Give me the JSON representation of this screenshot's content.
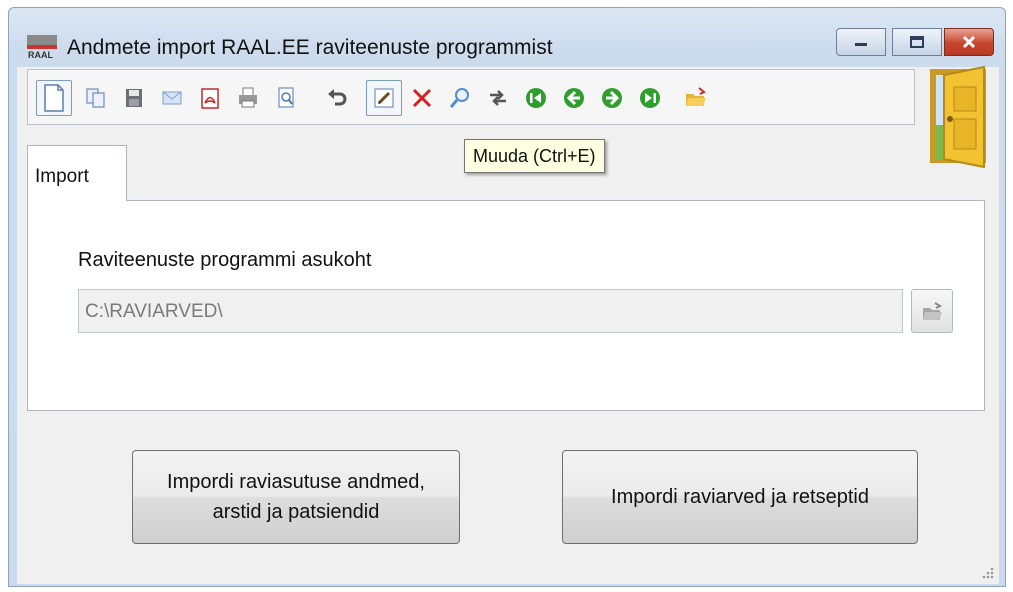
{
  "window": {
    "title": "Andmete import RAAL.EE raviteenuste programmist"
  },
  "toolbar": {
    "items": [
      {
        "name": "new-document-icon"
      },
      {
        "name": "copy-icon"
      },
      {
        "name": "save-icon"
      },
      {
        "name": "email-icon"
      },
      {
        "name": "pdf-icon"
      },
      {
        "name": "print-icon"
      },
      {
        "name": "print-preview-icon"
      },
      {
        "name": "undo-icon"
      },
      {
        "name": "edit-icon"
      },
      {
        "name": "delete-icon"
      },
      {
        "name": "search-icon"
      },
      {
        "name": "refresh-icon"
      },
      {
        "name": "first-record-icon"
      },
      {
        "name": "previous-record-icon"
      },
      {
        "name": "next-record-icon"
      },
      {
        "name": "last-record-icon"
      },
      {
        "name": "open-folder-icon"
      }
    ],
    "tooltip": "Muuda (Ctrl+E)"
  },
  "tabs": [
    {
      "label": "Import",
      "active": true
    }
  ],
  "import_panel": {
    "location_label": "Raviteenuste programmi asukoht",
    "location_value": "C:\\RAVIARVED\\"
  },
  "buttons": {
    "import_institution_line1": "Impordi raviasutuse andmed,",
    "import_institution_line2": "arstid ja patsiendid",
    "import_invoices": "Impordi raviarved ja retseptid"
  },
  "colors": {
    "nav_green": "#2f9e2f",
    "delete_red": "#d42020",
    "tooltip_bg": "#ffffe1",
    "close_red": "#c9452d"
  }
}
